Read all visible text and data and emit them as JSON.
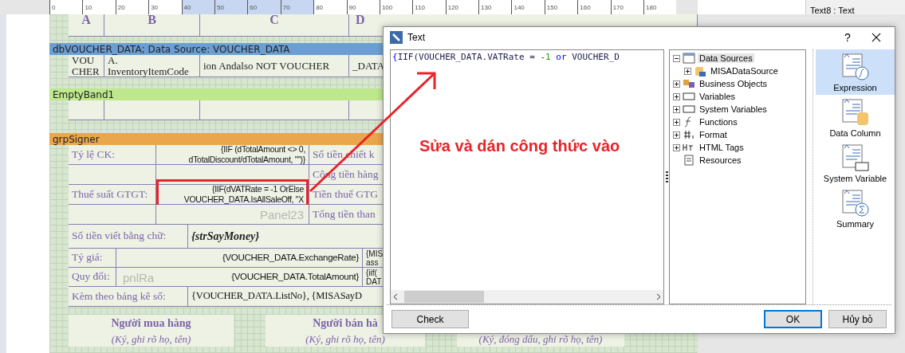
{
  "ruler": {
    "ticks": [
      {
        "label": "0",
        "selected": false
      },
      {
        "label": "10",
        "selected": false
      },
      {
        "label": "20",
        "selected": false
      },
      {
        "label": "30",
        "selected": false
      },
      {
        "label": "40",
        "selected": true
      },
      {
        "label": "50",
        "selected": true
      },
      {
        "label": "60",
        "selected": true
      },
      {
        "label": "70",
        "selected": true
      },
      {
        "label": "80",
        "selected": false
      },
      {
        "label": "90",
        "selected": false
      },
      {
        "label": "100",
        "selected": false
      },
      {
        "label": "110",
        "selected": false
      },
      {
        "label": "120",
        "selected": false
      },
      {
        "label": "130",
        "selected": false
      },
      {
        "label": "140",
        "selected": false
      },
      {
        "label": "150",
        "selected": false
      },
      {
        "label": "160",
        "selected": false
      },
      {
        "label": "170",
        "selected": false
      },
      {
        "label": "180",
        "selected": false
      }
    ]
  },
  "properties_panel": {
    "title": "Text8 : Text"
  },
  "report": {
    "column_headers": [
      "A",
      "B",
      "C",
      "D"
    ],
    "data_band": {
      "title": "dbVOUCHER_DATA; Data Source: VOUCHER_DATA",
      "cells": [
        "VOU CHER",
        "A. InventoryItemCode",
        "ion Andalso NOT VOUCHER",
        "_DATA"
      ]
    },
    "empty_band": {
      "title": "EmptyBand1"
    },
    "group_band": {
      "title": "grpSigner"
    },
    "summary_rows": [
      {
        "label": "Tỷ lệ CK:",
        "value": [
          "{IIF (dTotalAmount <> 0,",
          "dTotalDiscount/dTotalAmount, \"\")}"
        ],
        "side": "Số tiền chiết k",
        "selected": false
      },
      {
        "side": "Cộng tiền hàng",
        "selected": false
      },
      {
        "label": "Thuế suất GTGT:",
        "value": [
          "{IIF(dVATRate = -1 OrElse",
          "VOUCHER_DATA.IsAllSaleOff, \"X"
        ],
        "side": "Tiền thuế GTG",
        "selected": true
      },
      {
        "side": "Tổng tiền than",
        "ghost": "Panel23",
        "selected": false
      }
    ],
    "amount_in_words": {
      "label": "Số tiền viết bằng chữ:",
      "value": "{strSayMoney}"
    },
    "exchange_rows": [
      {
        "label": "Tỷ giá:",
        "value": "{VOUCHER_DATA.ExchangeRate}",
        "side": [
          "{MIS",
          "ass"
        ]
      },
      {
        "label": "Quy đổi:",
        "value": "{VOUCHER_DATA.TotalAmount}",
        "side": [
          "{iif(",
          "DAT"
        ]
      }
    ],
    "exchange_ghost": "pnlRa",
    "attachment": {
      "label": "Kèm theo bảng kê số:",
      "value": "{VOUCHER_DATA.ListNo}, {MISASayD"
    },
    "signers": [
      {
        "title": "Người mua hàng",
        "note": "(Ký, ghi rõ họ, tên)"
      },
      {
        "title": "Người bán hà",
        "note": "(Ký, ghi rõ họ, tên)"
      },
      {
        "note": "(Ký, đóng dấu, ghi rõ họ, tên)"
      }
    ]
  },
  "dialog": {
    "title": "Text",
    "help": "?",
    "code": [
      {
        "kind": "brace",
        "text": "{"
      },
      {
        "kind": "plain",
        "text": "IIF(VOUCHER_DATA.VATRate = -"
      },
      {
        "kind": "number",
        "text": "1"
      },
      {
        "kind": "keyword",
        "text": " or"
      },
      {
        "kind": "plain",
        "text": " VOUCHER_D"
      }
    ],
    "tree": [
      {
        "label": "Data Sources",
        "kind": "table",
        "expanded": true,
        "selected": true,
        "children": [
          {
            "label": "MISADataSource",
            "kind": "database",
            "expanded": false,
            "selected": false
          }
        ]
      },
      {
        "label": "Business Objects",
        "kind": "objects",
        "expanded": false,
        "selected": false
      },
      {
        "label": "Variables",
        "kind": "variables",
        "expanded": false,
        "selected": false
      },
      {
        "label": "System Variables",
        "kind": "system",
        "expanded": false,
        "selected": false
      },
      {
        "label": "Functions",
        "kind": "functions",
        "expanded": false,
        "selected": false
      },
      {
        "label": "Format",
        "kind": "format",
        "expanded": false,
        "selected": false
      },
      {
        "label": "HTML Tags",
        "kind": "html",
        "expanded": false,
        "selected": false
      },
      {
        "label": "Resources",
        "kind": "resources",
        "selected": false
      }
    ],
    "insert_types": [
      {
        "label": "Expression",
        "kind": "expression",
        "selected": true
      },
      {
        "label": "Data Column",
        "kind": "column",
        "selected": false
      },
      {
        "label": "System Variable",
        "kind": "system",
        "selected": false
      },
      {
        "label": "Summary",
        "kind": "summary",
        "selected": false
      }
    ],
    "buttons": {
      "check": "Check",
      "ok": "OK",
      "cancel": "Hủy bỏ"
    }
  },
  "annotation": {
    "text": "Sửa và dán công thức vào"
  }
}
